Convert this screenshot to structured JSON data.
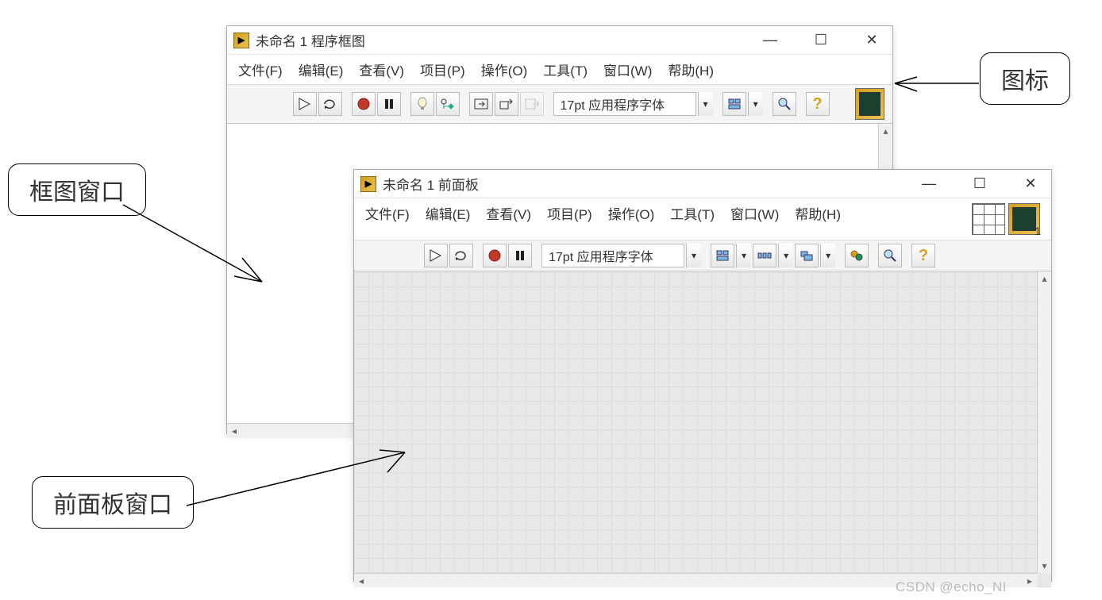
{
  "block_diagram": {
    "title": "未命名 1 程序框图",
    "menu": [
      "文件(F)",
      "编辑(E)",
      "查看(V)",
      "项目(P)",
      "操作(O)",
      "工具(T)",
      "窗口(W)",
      "帮助(H)"
    ],
    "font_label": "17pt 应用程序字体"
  },
  "front_panel": {
    "title": "未命名 1 前面板",
    "menu": [
      "文件(F)",
      "编辑(E)",
      "查看(V)",
      "项目(P)",
      "操作(O)",
      "工具(T)",
      "窗口(W)",
      "帮助(H)"
    ],
    "font_label": "17pt 应用程序字体",
    "vi_number": "1"
  },
  "callouts": {
    "icon_label": "图标",
    "bd_window_label": "框图窗口",
    "fp_window_label": "前面板窗口"
  },
  "watermark": "CSDN @echo_NI"
}
